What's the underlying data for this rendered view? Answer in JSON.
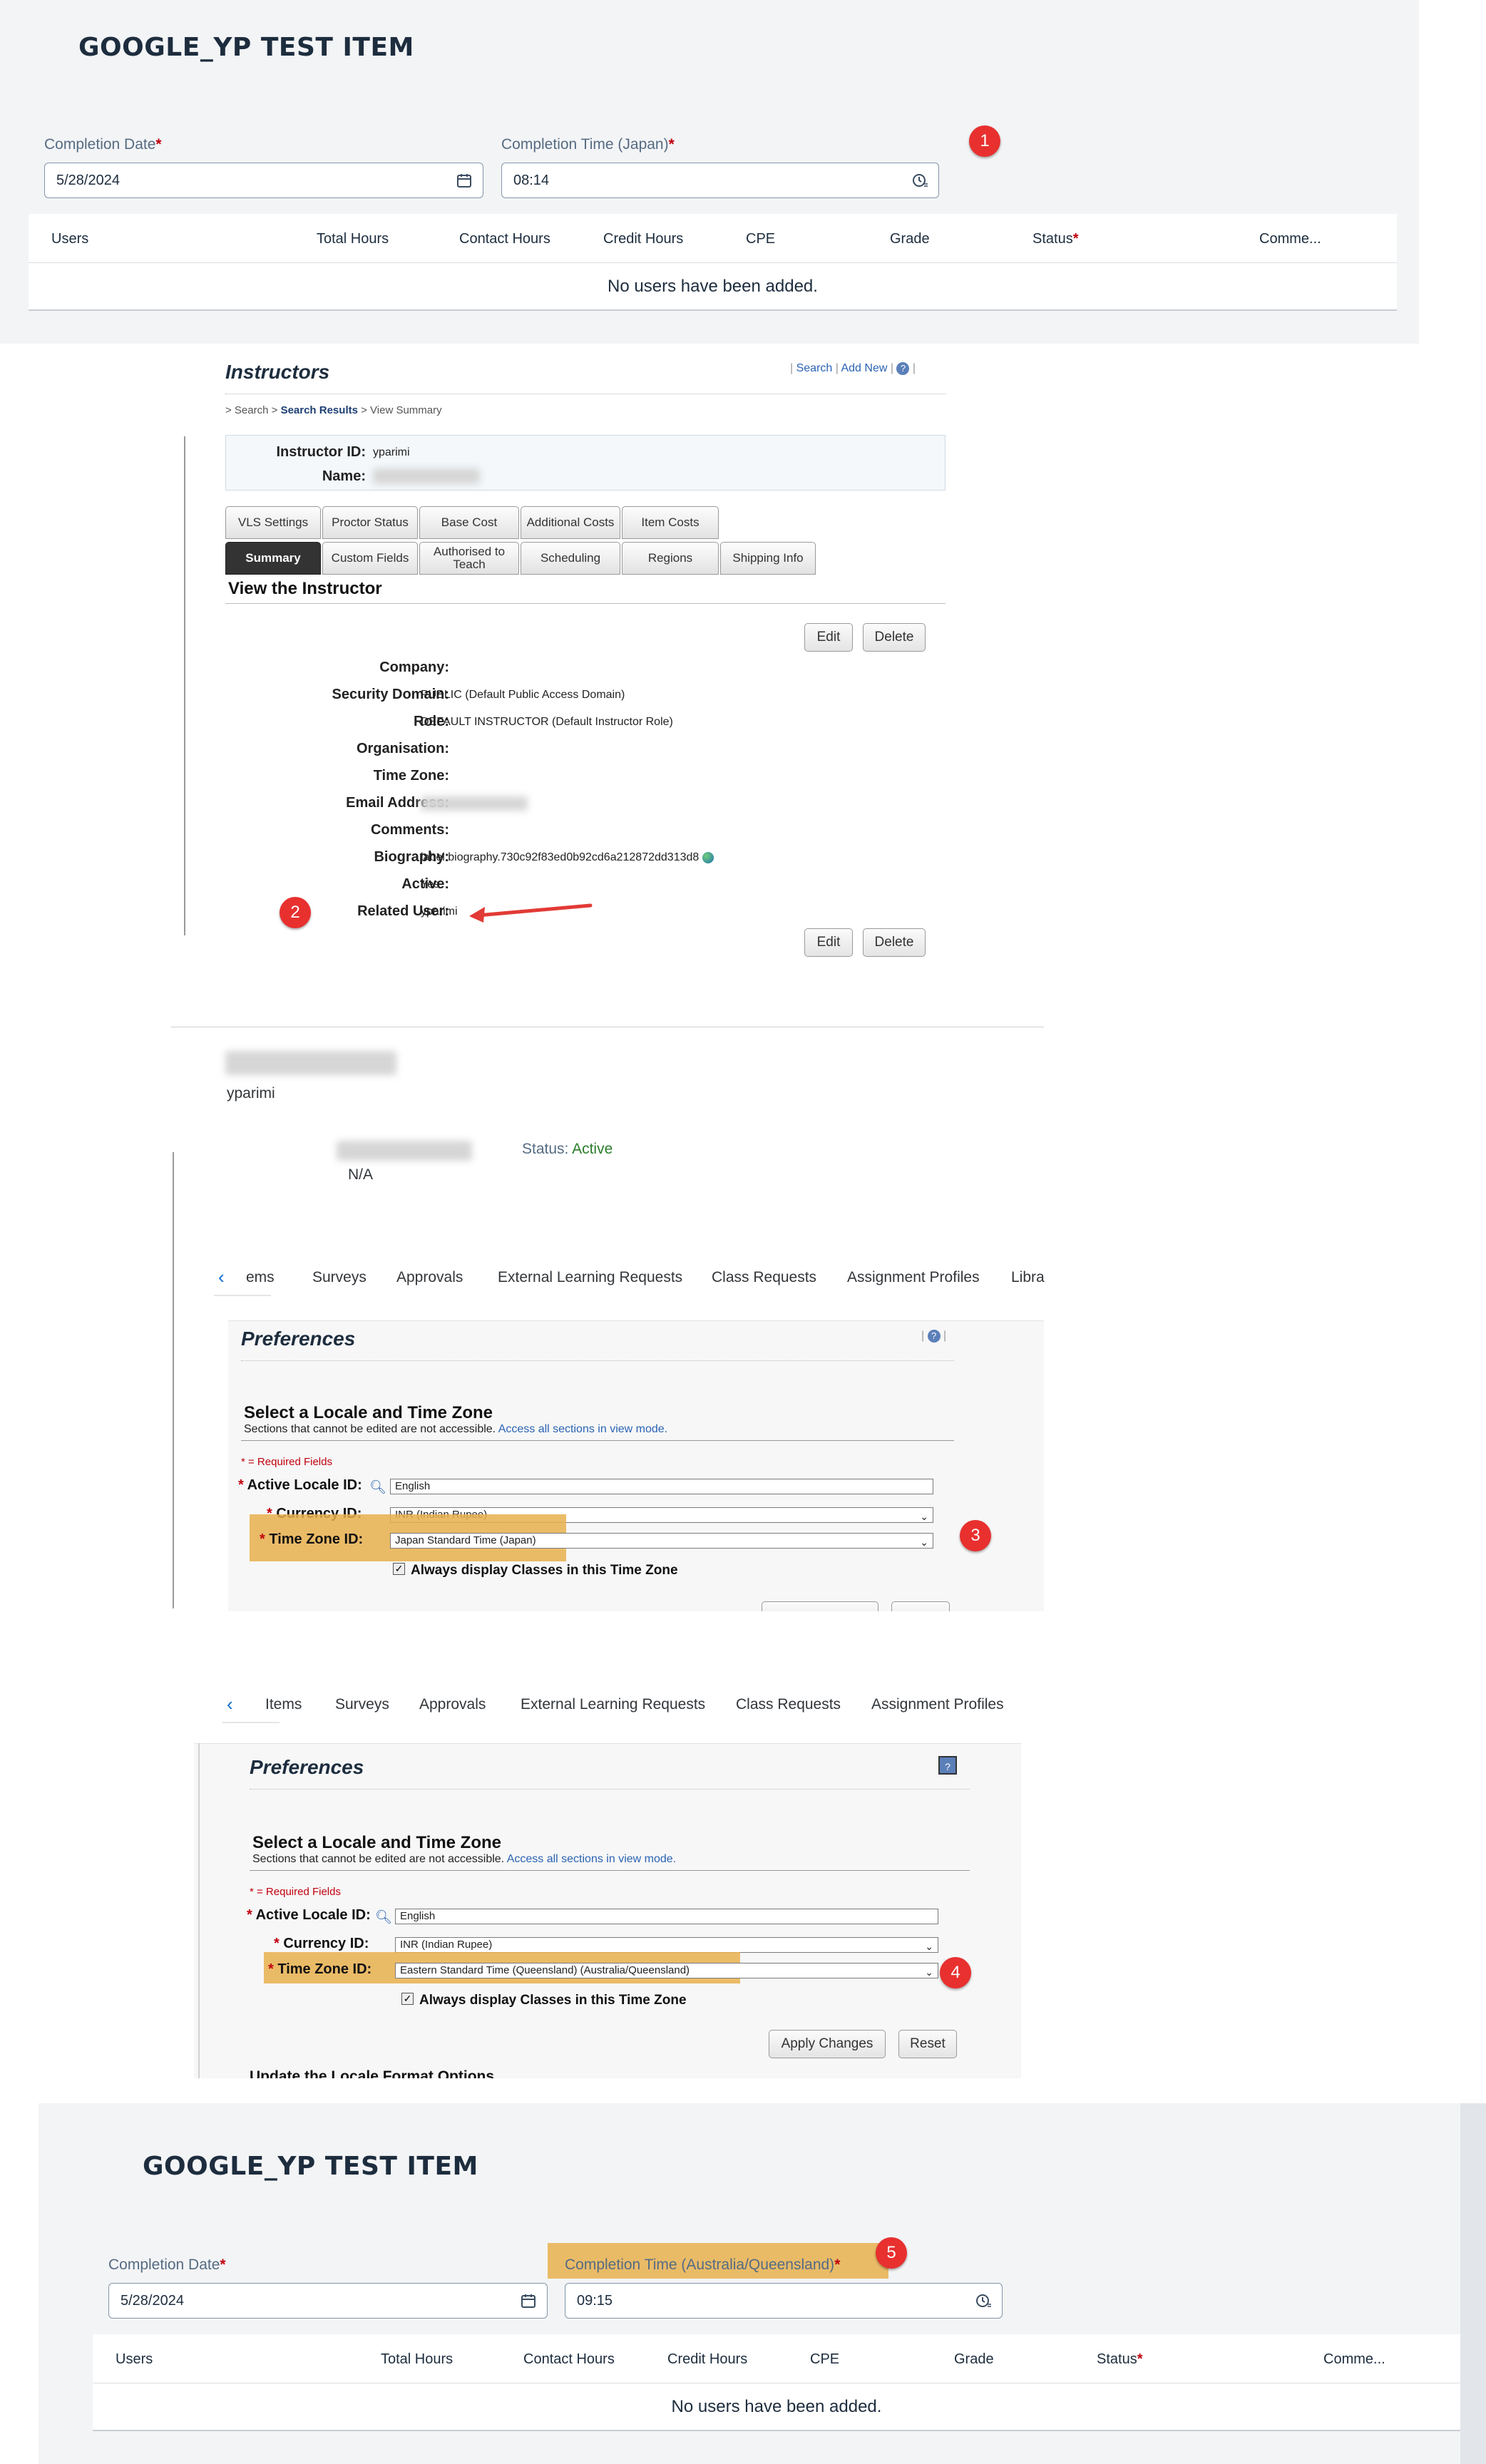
{
  "panel1": {
    "title": "GOOGLE_YP TEST ITEM",
    "date_label": "Completion Date",
    "date_value": "5/28/2024",
    "time_label": "Completion Time (Japan)",
    "time_value": "08:14",
    "required_mark": "*",
    "columns": [
      "Users",
      "Total Hours",
      "Contact Hours",
      "Credit Hours",
      "CPE",
      "Grade",
      "Status",
      "Comme..."
    ],
    "empty_text": "No users have been added.",
    "badge": "1"
  },
  "panel2": {
    "title": "Instructors",
    "links": [
      "Search",
      "Add New"
    ],
    "breadcrumb_prefix": "> Search > ",
    "breadcrumb_link": "Search Results",
    "breadcrumb_suffix": " > View Summary",
    "id_label": "Instructor ID:",
    "id_value": "yparimi",
    "name_label": "Name:",
    "tabs_row1": [
      "VLS Settings",
      "Proctor Status",
      "Base Cost",
      "Additional Costs",
      "Item Costs"
    ],
    "tabs_row2": [
      "Summary",
      "Custom Fields",
      "Authorised to Teach",
      "Scheduling",
      "Regions",
      "Shipping Info"
    ],
    "section_title": "View the Instructor",
    "edit_label": "Edit",
    "delete_label": "Delete",
    "fields": [
      {
        "label": "Company:",
        "value": ""
      },
      {
        "label": "Security Domain:",
        "value": "PUBLIC (Default Public Access Domain)"
      },
      {
        "label": "Role:",
        "value": "DEFAULT INSTRUCTOR (Default Instructor Role)"
      },
      {
        "label": "Organisation:",
        "value": ""
      },
      {
        "label": "Time Zone:",
        "value": ""
      },
      {
        "label": "Email Address:",
        "value": ""
      },
      {
        "label": "Comments:",
        "value": ""
      },
      {
        "label": "Biography:",
        "value": "label.biography.730c92f83ed0b92cd6a212872dd313d8"
      },
      {
        "label": "Active:",
        "value": "Yes"
      },
      {
        "label": "Related User:",
        "value": "yparimi"
      }
    ],
    "badge": "2"
  },
  "panel3": {
    "username": "yparimi",
    "status_label": "Status:",
    "status_value": "Active",
    "na_text": "N/A",
    "nav_tabs": [
      "ems",
      "Surveys",
      "Approvals",
      "External Learning Requests",
      "Class Requests",
      "Assignment Profiles",
      "Libra"
    ],
    "pref_title": "Preferences",
    "sec_title": "Select a Locale and Time Zone",
    "sec_sub": "Sections that cannot be edited are not accessible.",
    "sec_link": "Access all sections in view mode.",
    "req_note": "* = Required Fields",
    "locale_label": "Active Locale ID:",
    "locale_value": "English",
    "currency_label": "Currency ID:",
    "currency_value": "INR (Indian Rupee)",
    "tz_label": "Time Zone ID:",
    "tz_value": "Japan Standard Time (Japan)",
    "checkbox_label": "Always display Classes in this Time Zone",
    "badge": "3"
  },
  "panel4": {
    "nav_tabs": [
      "Items",
      "Surveys",
      "Approvals",
      "External Learning Requests",
      "Class Requests",
      "Assignment Profiles"
    ],
    "pref_title": "Preferences",
    "sec_title": "Select a Locale and Time Zone",
    "sec_sub": "Sections that cannot be edited are not accessible.",
    "sec_link": "Access all sections in view mode.",
    "req_note": "* = Required Fields",
    "locale_label": "Active Locale ID:",
    "locale_value": "English",
    "currency_label": "Currency ID:",
    "currency_value": "INR (Indian Rupee)",
    "tz_label": "Time Zone ID:",
    "tz_value": "Eastern Standard Time (Queensland) (Australia/Queensland)",
    "checkbox_label": "Always display Classes in this Time Zone",
    "apply_label": "Apply Changes",
    "reset_label": "Reset",
    "next_section": "Update the Locale Format Options",
    "badge": "4"
  },
  "panel5": {
    "title": "GOOGLE_YP TEST ITEM",
    "date_label": "Completion Date",
    "date_value": "5/28/2024",
    "time_label": "Completion Time (Australia/Queensland)",
    "time_value": "09:15",
    "required_mark": "*",
    "columns": [
      "Users",
      "Total Hours",
      "Contact Hours",
      "Credit Hours",
      "CPE",
      "Grade",
      "Status",
      "Comme..."
    ],
    "empty_text": "No users have been added.",
    "badge": "5"
  },
  "colors": {
    "badge": "#e8302f",
    "highlight": "#e8b04d",
    "active_status": "#2b7d2b",
    "title": "#1d2d3e",
    "link": "#2a63b3"
  }
}
